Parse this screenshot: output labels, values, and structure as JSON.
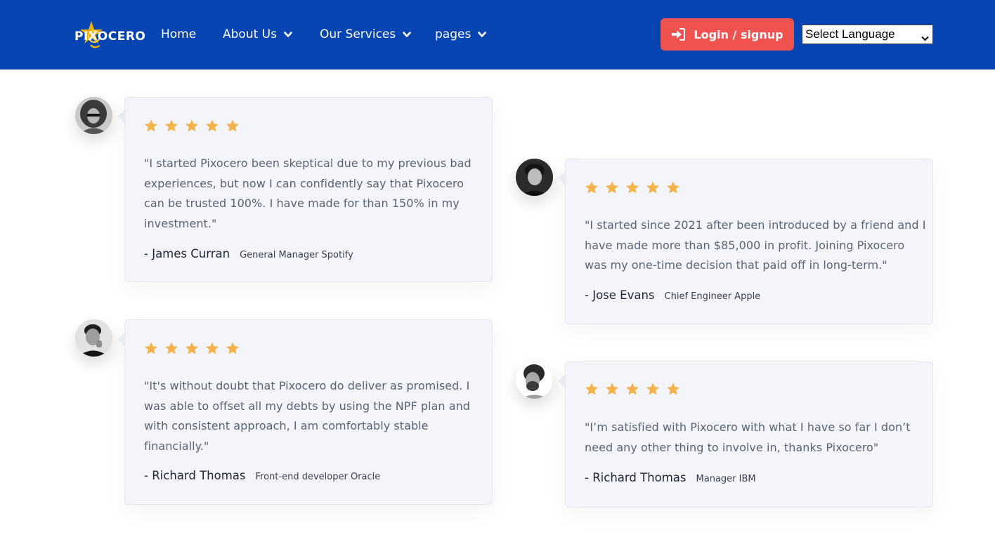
{
  "header": {
    "logo_text": "PIXOCERO",
    "nav": [
      {
        "label": "Home",
        "has_dropdown": false
      },
      {
        "label": "About Us",
        "has_dropdown": true
      },
      {
        "label": "Our Services",
        "has_dropdown": true
      },
      {
        "label": "pages",
        "has_dropdown": true
      }
    ],
    "login_label": "Login / signup",
    "language_select": "Select Language"
  },
  "colors": {
    "header_bg": "#0645b1",
    "login_bg": "#f0524f",
    "star": "#f6b24a",
    "card_bg": "#f4f5fa"
  },
  "testimonials": [
    {
      "rating": 5,
      "quote_lines": [
        "\"I started Pixocero been skeptical due to my previous bad",
        "experiences, but now I can confidently say that Pixocero",
        "can be trusted 100%. I have made for than 150% in my",
        "investment.\""
      ],
      "name": "- James Curran",
      "role": "General Manager Spotify"
    },
    {
      "rating": 5,
      "quote_lines": [
        "\"I started since 2021 after been introduced by a friend and I",
        "have made more than $85,000 in profit. Joining Pixocero",
        "was my one-time decision that paid off in long-term.\""
      ],
      "name": "- Jose Evans",
      "role": "Chief Engineer Apple"
    },
    {
      "rating": 5,
      "quote_lines": [
        "\"It's without doubt that Pixocero do deliver as promised. I",
        "was able to offset all my debts by using the NPF plan and",
        "with consistent approach, I am comfortably stable",
        "financially.\""
      ],
      "name": "- Richard Thomas",
      "role": "Front-end developer Oracle"
    },
    {
      "rating": 5,
      "quote_lines": [
        "\"I’m satisfied with Pixocero with what I have so far I don’t",
        "need any other thing to involve in, thanks Pixocero\""
      ],
      "name": "- Richard Thomas",
      "role": "Manager IBM"
    }
  ]
}
